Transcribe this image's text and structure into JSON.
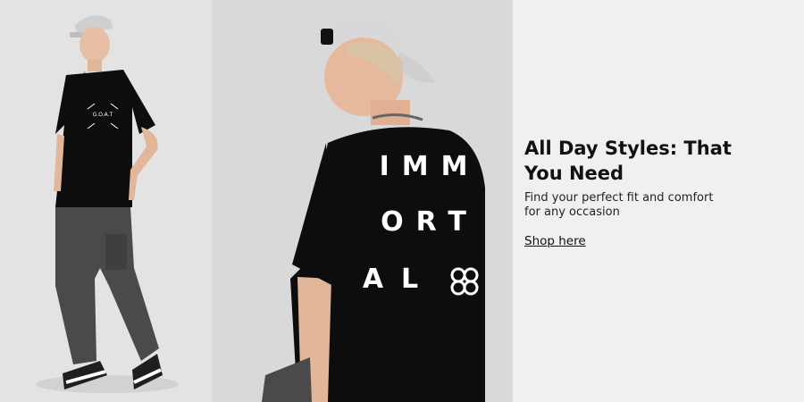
{
  "banner": {
    "title_line1": "All Day Styles: That",
    "title_line2": "You Need",
    "subtitle_line1": "Find your perfect fit and comfort",
    "subtitle_line2": "for any occasion",
    "cta_label": "Shop here"
  },
  "left_photo": {
    "tee_print": "G.O.A.T"
  },
  "mid_photo": {
    "back_print_row1": "IMM",
    "back_print_row2": "ORT",
    "back_print_row3": "AL"
  },
  "colors": {
    "panel_bg": "#f0f0f0",
    "text": "#111111",
    "tee": "#0d0d0d",
    "pants": "#4a4a4a",
    "cap": "#d8d8d8"
  }
}
